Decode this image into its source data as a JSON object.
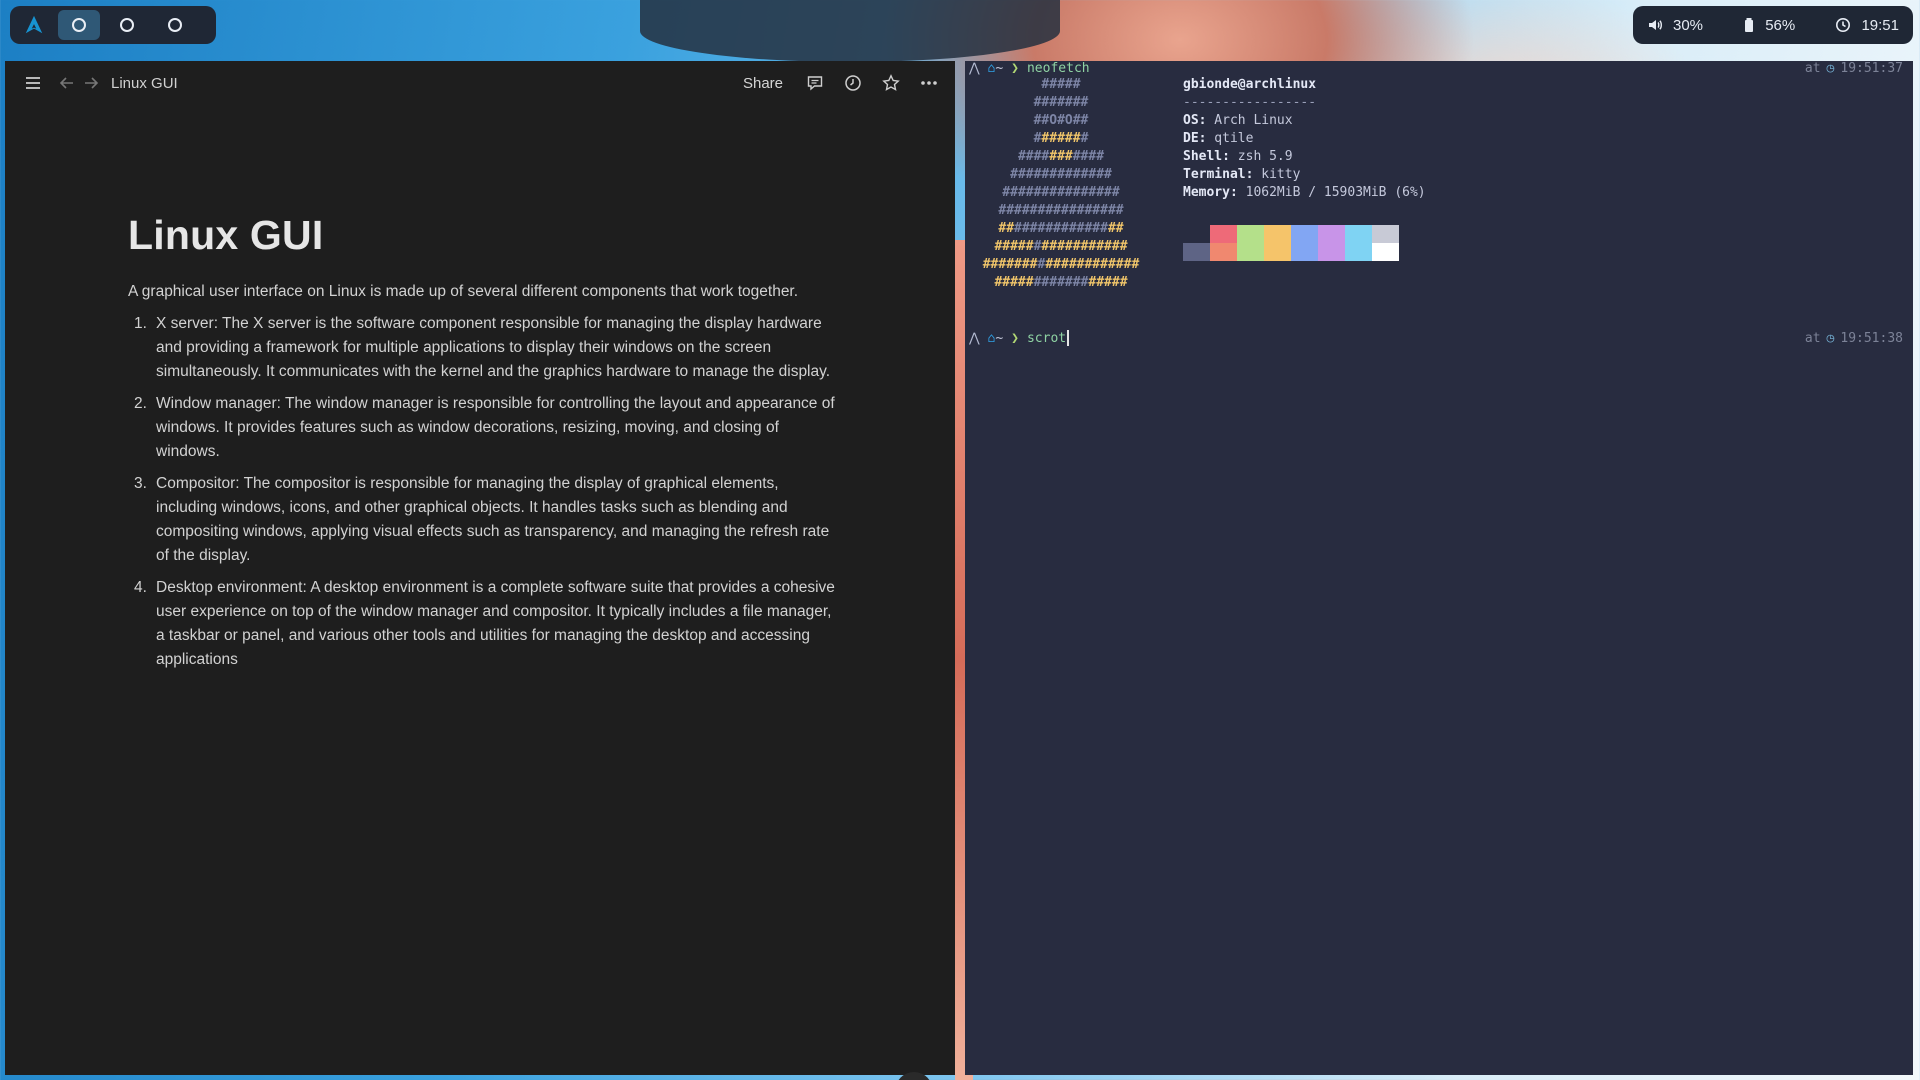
{
  "topbar": {
    "launcher_icon": "arch-logo-icon",
    "workspaces": [
      {
        "icon": "circle-icon",
        "active": true
      },
      {
        "icon": "circle-icon",
        "active": false
      },
      {
        "icon": "circle-icon",
        "active": false
      }
    ],
    "volume": {
      "icon": "speaker-icon",
      "value": "30%"
    },
    "battery": {
      "icon": "battery-icon",
      "value": "56%"
    },
    "clock": {
      "icon": "clock-icon",
      "value": "19:51"
    }
  },
  "notes": {
    "breadcrumb": "Linux GUI",
    "share_label": "Share",
    "header_icons": [
      "menu-icon",
      "back-arrow-icon",
      "forward-arrow-icon",
      "comment-icon",
      "history-icon",
      "star-icon",
      "more-icon"
    ],
    "title": "Linux GUI",
    "intro": "A graphical user interface on Linux is made up of several different components that work together.",
    "items": [
      {
        "num": "1.",
        "text": "X server: The X server is the software component responsible for managing the display hardware and providing a framework for multiple applications to display their windows on the screen simultaneously. It communicates with the kernel and the graphics hardware to manage the display."
      },
      {
        "num": "2.",
        "text": "Window manager: The window manager is responsible for controlling the layout and appearance of windows. It provides features such as window decorations, resizing, moving, and closing of windows."
      },
      {
        "num": "3.",
        "text": "Compositor: The compositor is responsible for managing the display of graphical elements, including windows, icons, and other graphical objects. It handles tasks such as blending and compositing windows, applying visual effects such as transparency, and managing the refresh rate of the display."
      },
      {
        "num": "4.",
        "text": "Desktop environment: A desktop environment is a complete software suite that provides a cohesive user experience on top of the window manager and compositor. It typically includes a file manager, a taskbar or panel, and various other tools and utilities for managing the desktop and accessing applications"
      }
    ],
    "help_label": "?"
  },
  "terminal": {
    "prompt_dir": "~",
    "prompt_symbol": "❯",
    "cmd1": "neofetch",
    "cmd2": "scrot",
    "at_label": "at",
    "time1": "19:51:37",
    "time2": "19:51:38",
    "neofetch": {
      "user": "gbionde@archlinux",
      "separator": "-----------------",
      "fields": [
        {
          "key": "OS:",
          "value": " Arch Linux"
        },
        {
          "key": "DE:",
          "value": " qtile"
        },
        {
          "key": "Shell:",
          "value": " zsh 5.9"
        },
        {
          "key": "Terminal:",
          "value": " kitty"
        },
        {
          "key": "Memory:",
          "value": " 1062MiB / 15903MiB (6%)"
        }
      ]
    },
    "logo_lines": [
      [
        {
          "t": "#####",
          "c": "c1"
        }
      ],
      [
        {
          "t": "#######",
          "c": "c1"
        }
      ],
      [
        {
          "t": "##O#O##",
          "c": "c1"
        }
      ],
      [
        {
          "t": "#",
          "c": "c1"
        },
        {
          "t": "#####",
          "c": "c2"
        },
        {
          "t": "#",
          "c": "c1"
        }
      ],
      [
        {
          "t": "##",
          "c": "c1"
        },
        {
          "t": "##",
          "c": "c1"
        },
        {
          "t": "###",
          "c": "c2"
        },
        {
          "t": "####",
          "c": "c1"
        }
      ],
      [
        {
          "t": "#############",
          "c": "c1"
        }
      ],
      [
        {
          "t": "###############",
          "c": "c1"
        }
      ],
      [
        {
          "t": "################",
          "c": "c1"
        }
      ],
      [
        {
          "t": "##",
          "c": "c2"
        },
        {
          "t": "############",
          "c": "c1"
        },
        {
          "t": "##",
          "c": "c2"
        }
      ],
      [
        {
          "t": "#####",
          "c": "c2"
        },
        {
          "t": "#",
          "c": "c1"
        },
        {
          "t": "#####",
          "c": "c2"
        },
        {
          "t": "######",
          "c": "c2"
        }
      ],
      [
        {
          "t": "#######",
          "c": "c2"
        },
        {
          "t": "#",
          "c": "c1"
        },
        {
          "t": "#####",
          "c": "c2"
        },
        {
          "t": "#######",
          "c": "c2"
        }
      ],
      [
        {
          "t": "#####",
          "c": "c2"
        },
        {
          "t": "#######",
          "c": "c1"
        },
        {
          "t": "#####",
          "c": "c2"
        }
      ]
    ],
    "swatches_top": [
      "#282c40",
      "#ee6a78",
      "#b4e08a",
      "#f5c46a",
      "#82a6f3",
      "#c894e8",
      "#7fd3f3",
      "#c8cad6"
    ],
    "swatches_bottom": [
      "#5e6485",
      "#f0886f",
      "#b4e08a",
      "#f5c46a",
      "#82a6f3",
      "#c894e8",
      "#7fd3f3",
      "#ffffff"
    ]
  }
}
